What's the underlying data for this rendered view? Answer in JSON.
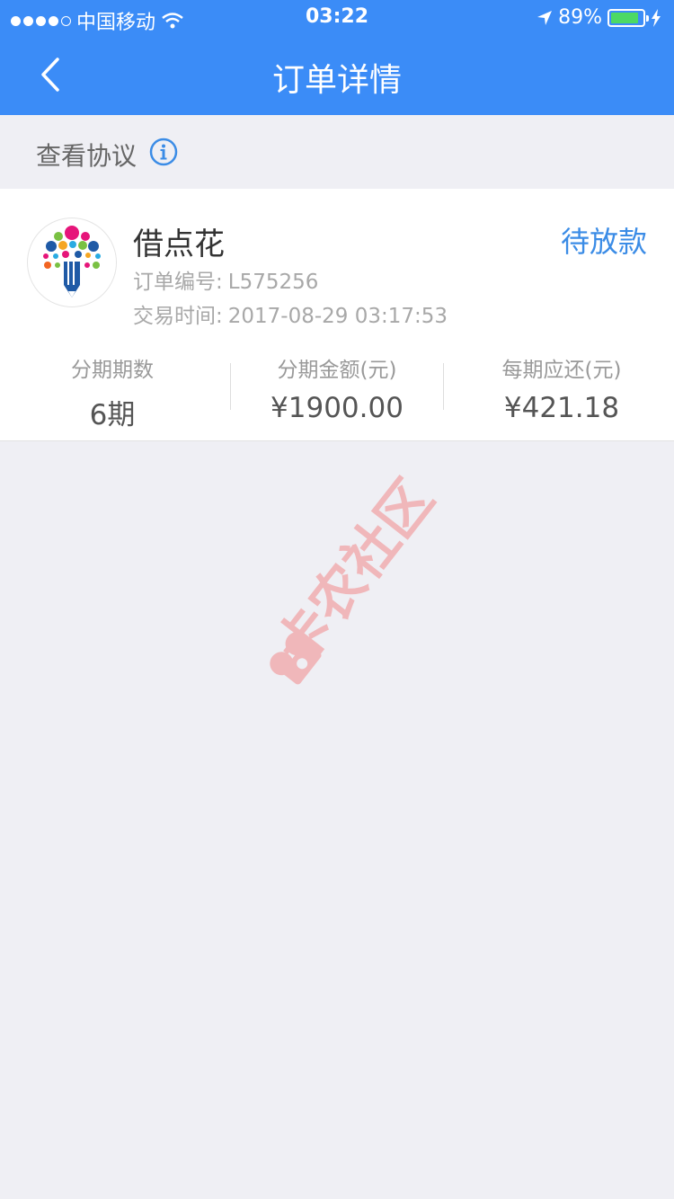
{
  "status_bar": {
    "carrier": "中国移动",
    "time": "03:22",
    "battery": "89%",
    "battery_level": 0.89,
    "icons": [
      "signal-dots-icon",
      "wifi-icon",
      "location-arrow-icon",
      "battery-icon",
      "charging-bolt-icon"
    ]
  },
  "nav": {
    "title": "订单详情",
    "back_icon": "chevron-left-icon"
  },
  "protocol": {
    "label": "查看协议",
    "icon": "info-circle-icon"
  },
  "order": {
    "merchant": "借点花",
    "logo_icon": "pencil-tree-logo",
    "status": "待放款",
    "number_label": "订单编号:",
    "number": "L575256",
    "time_label": "交易时间:",
    "time": "2017-08-29 03:17:53"
  },
  "stats": [
    {
      "label": "分期期数",
      "value": "6期"
    },
    {
      "label": "分期金额(元)",
      "value": "¥1900.00"
    },
    {
      "label": "每期应还(元)",
      "value": "¥421.18"
    }
  ],
  "watermark": {
    "text": "卡农社区",
    "color": "#f28b8b"
  },
  "colors": {
    "primary": "#3b8cf7",
    "status_text": "#3b8ce6",
    "background": "#efeff4"
  }
}
